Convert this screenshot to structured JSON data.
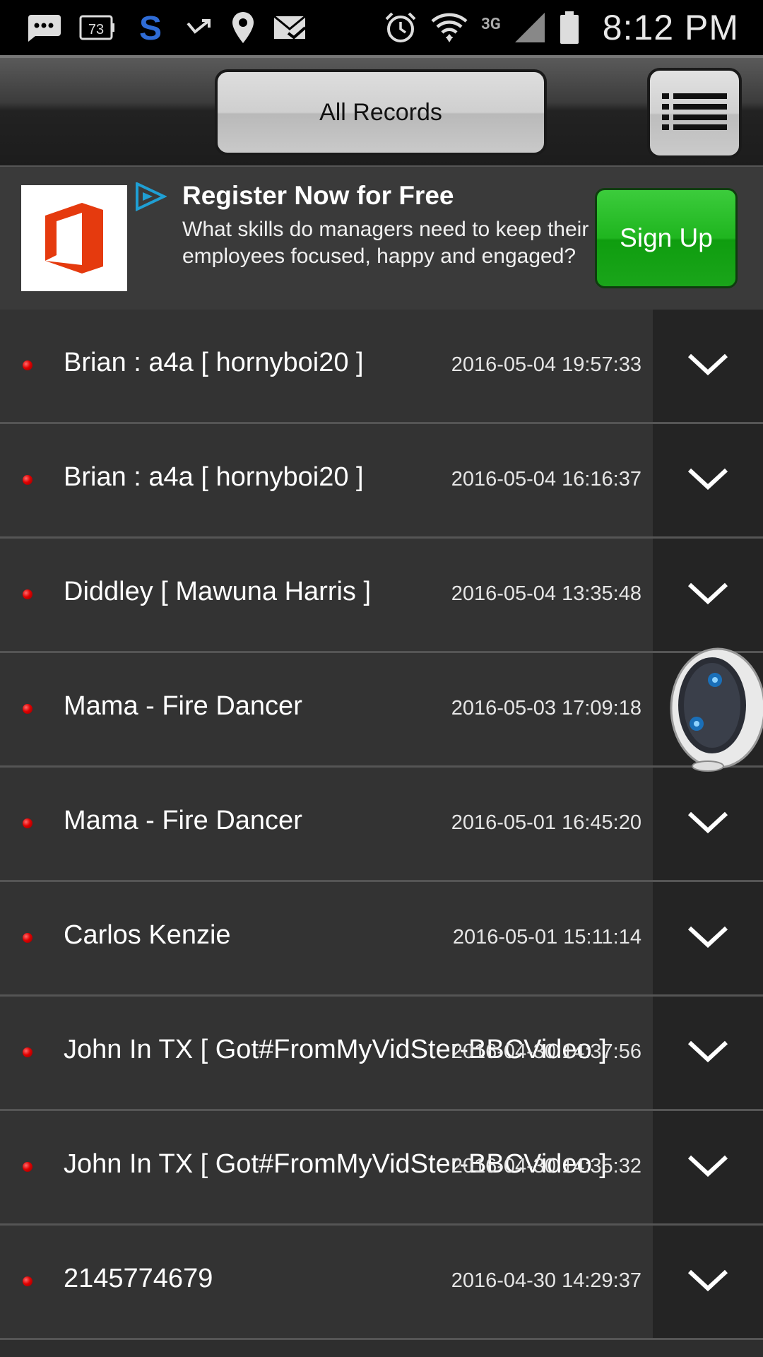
{
  "status_bar": {
    "time": "8:12 PM",
    "battery_badge": "73",
    "network_label": "3G",
    "icons": [
      "message-icon",
      "battery-badge-icon",
      "skype-icon",
      "missed-call-icon",
      "location-icon",
      "mail-icon",
      "alarm-icon",
      "wifi-icon",
      "signal-icon",
      "battery-icon"
    ]
  },
  "header": {
    "filter_button": "All Records",
    "menu_icon": "list-menu-icon"
  },
  "ad": {
    "title": "Register Now for Free",
    "body": "What skills do managers need to keep their employees focused, happy and engaged?",
    "cta": "Sign Up",
    "logo_icon": "office-logo-icon",
    "adchoices_icon": "adchoices-icon",
    "accent": "#1fb51f"
  },
  "records": [
    {
      "name": "Brian : a4a [ hornyboi20 ]",
      "date": "2016-05-04 19:57:33"
    },
    {
      "name": "Brian : a4a [ hornyboi20 ]",
      "date": "2016-05-04 16:16:37"
    },
    {
      "name": "Diddley [ Mawuna Harris ]",
      "date": "2016-05-04 13:35:48"
    },
    {
      "name": "Mama - Fire Dancer",
      "date": "2016-05-03 17:09:18"
    },
    {
      "name": "Mama - Fire Dancer",
      "date": "2016-05-01 16:45:20"
    },
    {
      "name": "Carlos Kenzie",
      "date": "2016-05-01 15:11:14"
    },
    {
      "name": "John In TX [ Got#FromMyVidSter-BBCVideo ]",
      "date": "2016-04-30 14:37:56"
    },
    {
      "name": "John In TX [ Got#FromMyVidSter-BBCVideo ]",
      "date": "2016-04-30 14:35:32"
    },
    {
      "name": "2145774679",
      "date": "2016-04-30 14:29:37"
    }
  ],
  "colors": {
    "status_dot": "#e00000",
    "row_bg": "#333333",
    "expand_bg": "#242424"
  }
}
